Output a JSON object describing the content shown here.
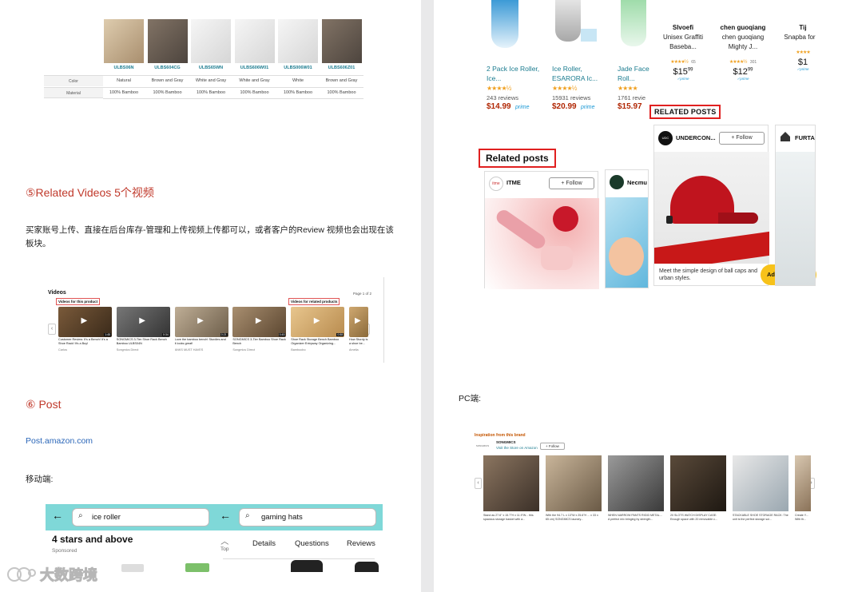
{
  "left": {
    "products": [
      {
        "sku": "ULBS06N",
        "color": "Natural",
        "material": "100% Bamboo",
        "tone": "wood"
      },
      {
        "sku": "ULBS604CG",
        "color": "Brown and Gray",
        "material": "100% Bamboo",
        "tone": "dark"
      },
      {
        "sku": "ULBS65WN",
        "color": "White and Gray",
        "material": "100% Bamboo",
        "tone": "white"
      },
      {
        "sku": "ULBS606W01",
        "color": "White and Gray",
        "material": "100% Bamboo",
        "tone": "white"
      },
      {
        "sku": "ULBS006W01",
        "color": "White",
        "material": "100% Bamboo",
        "tone": "white"
      },
      {
        "sku": "ULBS606Z01",
        "color": "Brown and Gray",
        "material": "100% Bamboo",
        "tone": "dark"
      }
    ],
    "row_color_label": "Color",
    "row_material_label": "Material",
    "section5_title": "⑤Related Videos 5个视频",
    "section5_desc": "买家账号上传、直接在后台库存-管理和上传视频上传都可以，或者客户的Review 视频也会出现在该板块。",
    "videos": {
      "title": "Videos",
      "page_indicator": "Page 1 of 2",
      "tab_product": "Videos for this product",
      "tab_related": "Videos for related products",
      "items": [
        {
          "caption": "Customer Review: It's a Bench! It's a Shoe Rack! It's a Buy!",
          "author": "Carlos",
          "duration": "1:45"
        },
        {
          "caption": "SONGMICS 3-Tier Shoe Rack Bench Bamboo ULBS04N",
          "author": "Songmics Direct",
          "duration": "0:34"
        },
        {
          "caption": "Love the bamboo bench! Sturdies and it looks great!",
          "author": "ANKS MUST HAVES",
          "duration": "0:21"
        },
        {
          "caption": "SONGMICS 3-Tier Bamboo Shoe Rack Bench",
          "author": "Songmics Direct",
          "duration": "0:45"
        },
        {
          "caption": "Shoe Rack Storage Bench Bamboo Organizer Entryway Organizing...",
          "author": "Bamboobo",
          "duration": "0:58"
        },
        {
          "caption": "How Sturdy is a shoe be...",
          "author": "Amelia",
          "duration": ""
        }
      ]
    },
    "section6_title": "⑥ Post",
    "post_link": "Post.amazon.com",
    "mobile_label": "移动端:",
    "mobile": {
      "search1": "ice roller",
      "search2": "gaming hats",
      "filter_title": "4 stars and above",
      "sponsored": "Sponsored",
      "top_label": "Top",
      "tabs": [
        "Details",
        "Questions",
        "Reviews"
      ]
    }
  },
  "right": {
    "products_left": [
      {
        "title": "2 Pack Ice Roller, Ice...",
        "stars": "★★★★½",
        "reviews": "243 reviews",
        "price": "$14.99",
        "prime": "prime"
      },
      {
        "title": "Ice Roller, ESARORA Ic...",
        "stars": "★★★★½",
        "reviews": "15931 reviews",
        "price": "$20.99",
        "prime": "prime"
      },
      {
        "title": "Jade Face Sha Roll...",
        "stars": "★★★★",
        "reviews": "1761 revie",
        "price": "$15.97",
        "prime": ""
      }
    ],
    "products_right": [
      {
        "brand": "Slvoefi",
        "title": "Unisex Graffiti Baseba...",
        "stars": "★★★★½",
        "count": "65",
        "price": "$15",
        "cents": "99"
      },
      {
        "brand": "chen guoqiang",
        "title": "chen guoqiang Mighty J...",
        "stars": "★★★★½",
        "count": "301",
        "price": "$12",
        "cents": "99"
      },
      {
        "brand": "Tij",
        "title": "Snapba for N",
        "stars": "★★★★",
        "count": "",
        "price": "$1",
        "cents": ""
      }
    ],
    "related_posts_caps": "RELATED POSTS",
    "related_posts": "Related posts",
    "post_cards": [
      {
        "brand": "ITME",
        "follow": "+ Follow"
      },
      {
        "brand": "Necmu",
        "follow": ""
      }
    ],
    "big_post": {
      "brand": "UNDERCON...",
      "follow": "+ Follow",
      "caption": "Meet the simple design of ball caps and urban styles.",
      "cta": "Add to Cart",
      "next_brand": "FURTA"
    },
    "pc_label": "PC端:",
    "pc": {
      "heading": "Inspiration from this brand",
      "brand": "SONGMICS",
      "visit": "Visit the Store on Amazon",
      "follow": "+ Follow",
      "captions": [
        "Stand as 27.6\" x 15.7\"H x 11.9\"W... this spacious storage basket with a...",
        "With the 94.7 L x 13\"W x 25.6\"H ... x 33 x 65 cm) SONGMICS laundry...",
        "WHEN NARROW PANTS RIGID METAL... A perfect mix bringing by strength...",
        "20 SLOTS WATCH DISPLAY CASE: Enough space with 20 removable c...",
        "STACKABLE SHOE STORAGE RACK: The unit is the perfect storage sol...",
        "Create Y... With th..."
      ]
    }
  },
  "watermark": "大数跨境",
  "colors": {
    "accent_red": "#c0392b",
    "box_red": "#e02020",
    "link_blue": "#2a66b8",
    "teal": "#1a7b8f",
    "mobile_bar": "#7fd8d8",
    "cta_yellow": "#f7c21a"
  }
}
